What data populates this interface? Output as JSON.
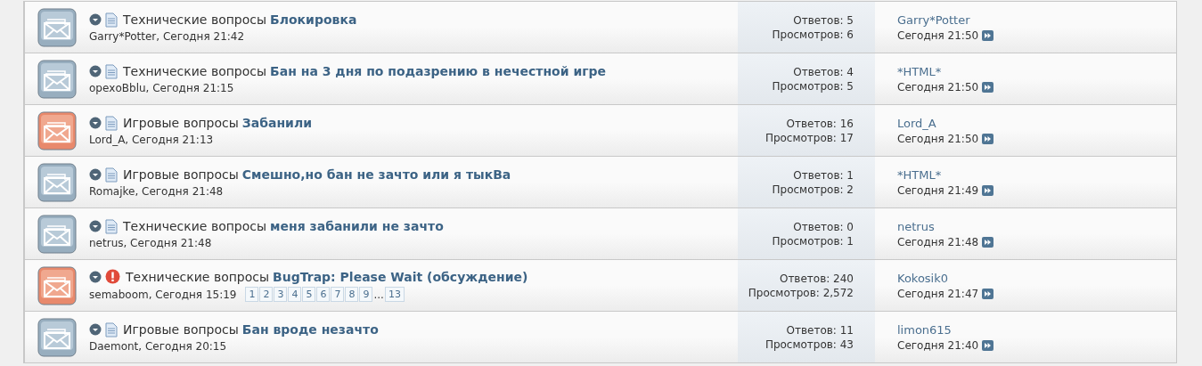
{
  "threads": [
    {
      "hot": false,
      "kind": "document",
      "prefix": "Технические вопросы",
      "title": "Блокировка",
      "author_line": "Garry*Potter, Сегодня 21:42",
      "replies": "Ответов: 5",
      "views": "Просмотров: 6",
      "last_poster": "Garry*Potter",
      "last_time": "Сегодня 21:50"
    },
    {
      "hot": false,
      "kind": "document",
      "prefix": "Технические вопросы",
      "title": "Бан на 3 дня по подазрению в нечестной игре",
      "author_line": "орехоBblu, Сегодня 21:15",
      "replies": "Ответов: 4",
      "views": "Просмотров: 5",
      "last_poster": "*HTML*",
      "last_time": "Сегодня 21:50"
    },
    {
      "hot": true,
      "kind": "document",
      "prefix": "Игровые вопросы",
      "title": "Забанили",
      "author_line": "Lord_A, Сегодня 21:13",
      "replies": "Ответов: 16",
      "views": "Просмотров: 17",
      "last_poster": "Lord_A",
      "last_time": "Сегодня 21:50"
    },
    {
      "hot": false,
      "kind": "document",
      "prefix": "Игровые вопросы",
      "title": "Смешно,но бан не зачто или я тыкВа",
      "author_line": "Romajke, Сегодня 21:48",
      "replies": "Ответов: 1",
      "views": "Просмотров: 2",
      "last_poster": "*HTML*",
      "last_time": "Сегодня 21:49"
    },
    {
      "hot": false,
      "kind": "document",
      "prefix": "Технические вопросы",
      "title": "меня забанили не зачто",
      "author_line": "netrus, Сегодня 21:48",
      "replies": "Ответов: 0",
      "views": "Просмотров: 1",
      "last_poster": "netrus",
      "last_time": "Сегодня 21:48"
    },
    {
      "hot": true,
      "kind": "alert",
      "prefix": "Технические вопросы",
      "title": "BugTrap: Please Wait (обсуждение)",
      "author_line": "semaboom, Сегодня 15:19",
      "pages": [
        "1",
        "2",
        "3",
        "4",
        "5",
        "6",
        "7",
        "8",
        "9"
      ],
      "ellipsis": "...",
      "last_page": "13",
      "replies": "Ответов: 240",
      "views": "Просмотров: 2,572",
      "last_poster": "Kokosik0",
      "last_time": "Сегодня 21:47"
    },
    {
      "hot": false,
      "kind": "document",
      "prefix": "Игровые вопросы",
      "title": "Бан вроде незачто",
      "author_line": "Daemont, Сегодня 20:15",
      "replies": "Ответов: 11",
      "views": "Просмотров: 43",
      "last_poster": "limon615",
      "last_time": "Сегодня 21:40"
    }
  ]
}
